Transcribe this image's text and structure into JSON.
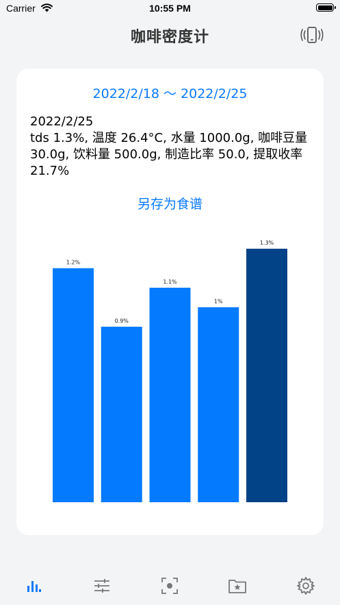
{
  "status_bar": {
    "carrier": "Carrier",
    "time": "10:55 PM"
  },
  "nav": {
    "title": "咖啡密度计",
    "action_icon": "phone-vibrate-icon"
  },
  "card": {
    "date_range": "2022/2/18 ～ 2022/2/25",
    "selected_date": "2022/2/25",
    "summary": "tds 1.3%, 温度 26.4°C, 水量 1000.0g, 咖啡豆量 30.0g, 饮料量 500.0g, 制造比率 50.0, 提取收率 21.7%",
    "save_recipe_label": "另存为食谱"
  },
  "colors": {
    "accent": "#0a7aff",
    "bar": "#047aff",
    "bar_selected": "#024286"
  },
  "chart_data": {
    "type": "bar",
    "values": [
      1.2,
      0.9,
      1.1,
      1.0,
      1.3
    ],
    "data_labels": [
      "1.2%",
      "0.9%",
      "1.1%",
      "1%",
      "1.3%"
    ],
    "selected_index": 4,
    "title": "",
    "xlabel": "",
    "ylabel": ""
  },
  "tab_bar": {
    "items": [
      {
        "icon": "bar-chart-icon",
        "active": true
      },
      {
        "icon": "sliders-icon",
        "active": false
      },
      {
        "icon": "scan-icon",
        "active": false
      },
      {
        "icon": "folder-star-icon",
        "active": false
      },
      {
        "icon": "gear-icon",
        "active": false
      }
    ]
  }
}
